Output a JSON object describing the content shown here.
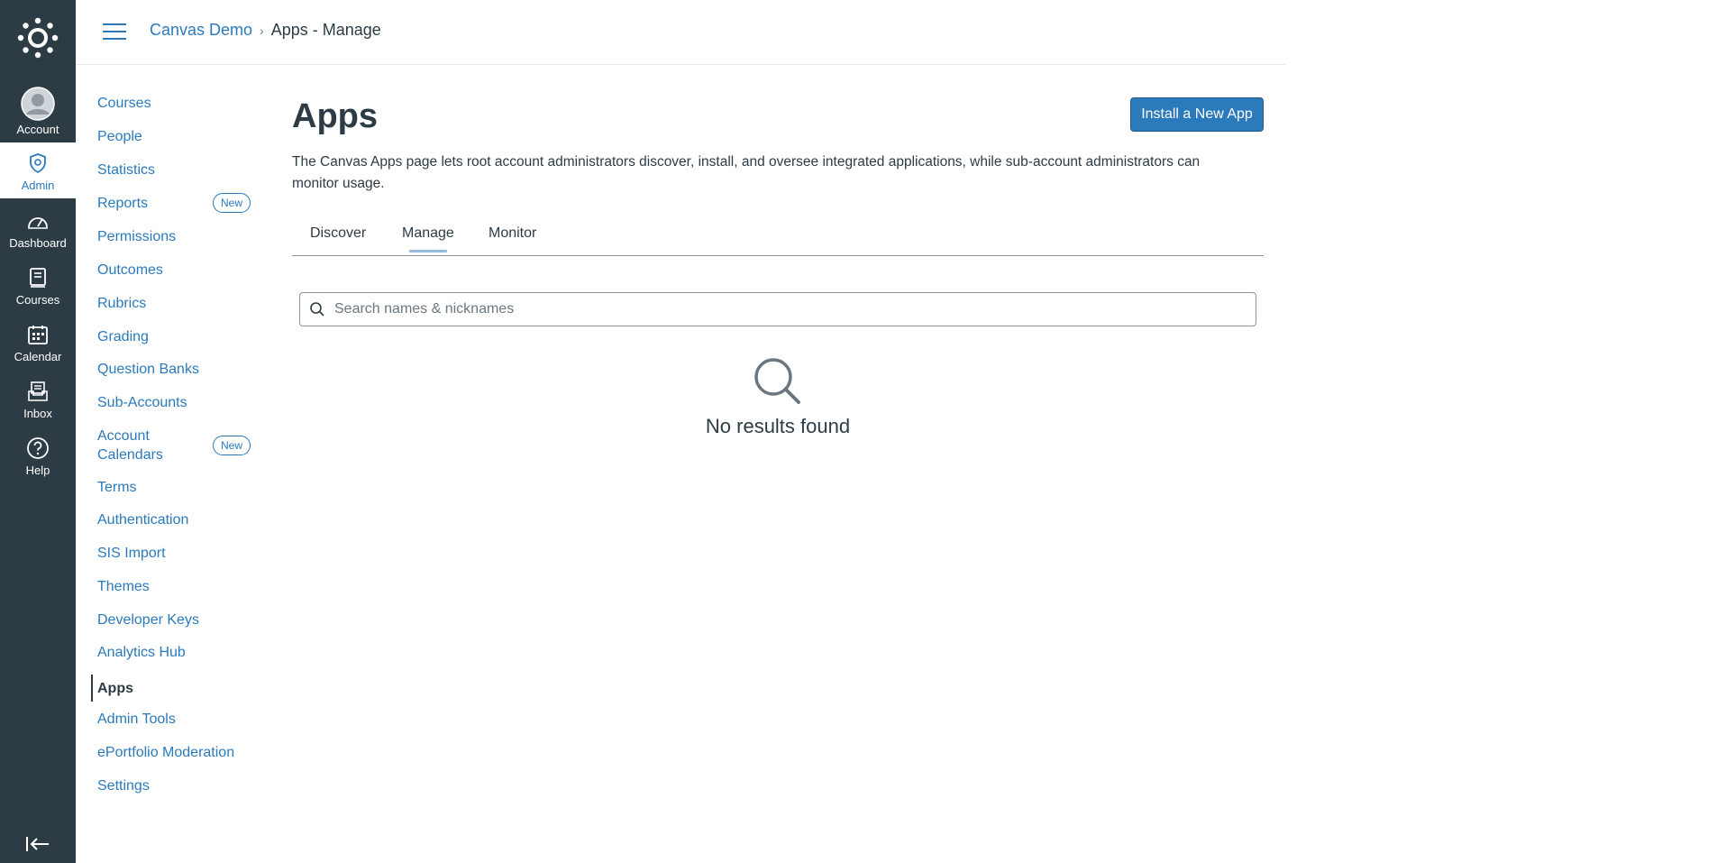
{
  "global_nav": {
    "items": [
      {
        "label": "Account",
        "icon": "account-avatar-icon"
      },
      {
        "label": "Admin",
        "icon": "admin-shield-icon",
        "active": true
      },
      {
        "label": "Dashboard",
        "icon": "dashboard-gauge-icon"
      },
      {
        "label": "Courses",
        "icon": "courses-book-icon"
      },
      {
        "label": "Calendar",
        "icon": "calendar-icon"
      },
      {
        "label": "Inbox",
        "icon": "inbox-icon"
      },
      {
        "label": "Help",
        "icon": "help-question-icon"
      }
    ]
  },
  "header": {
    "breadcrumb_root": "Canvas Demo",
    "breadcrumb_current": "Apps - Manage"
  },
  "subnav": {
    "items": [
      {
        "label": "Courses"
      },
      {
        "label": "People"
      },
      {
        "label": "Statistics"
      },
      {
        "label": "Reports",
        "badge": "New"
      },
      {
        "label": "Permissions"
      },
      {
        "label": "Outcomes"
      },
      {
        "label": "Rubrics"
      },
      {
        "label": "Grading"
      },
      {
        "label": "Question Banks"
      },
      {
        "label": "Sub-Accounts"
      },
      {
        "label": "Account Calendars",
        "badge": "New"
      },
      {
        "label": "Terms"
      },
      {
        "label": "Authentication"
      },
      {
        "label": "SIS Import"
      },
      {
        "label": "Themes"
      },
      {
        "label": "Developer Keys"
      },
      {
        "label": "Analytics Hub"
      },
      {
        "label": "Apps",
        "active": true
      },
      {
        "label": "Admin Tools"
      },
      {
        "label": "ePortfolio Moderation"
      },
      {
        "label": "Settings"
      }
    ]
  },
  "main": {
    "title": "Apps",
    "install_button": "Install a New App",
    "description": "The Canvas Apps page lets root account administrators discover, install, and oversee integrated applications, while sub-account administrators can monitor usage.",
    "tabs": [
      {
        "label": "Discover"
      },
      {
        "label": "Manage",
        "active": true
      },
      {
        "label": "Monitor"
      }
    ],
    "search_placeholder": "Search names & nicknames",
    "empty_state": "No results found"
  },
  "colors": {
    "nav_bg": "#2d3b45",
    "accent": "#2b7abc",
    "text": "#2d3b45"
  }
}
